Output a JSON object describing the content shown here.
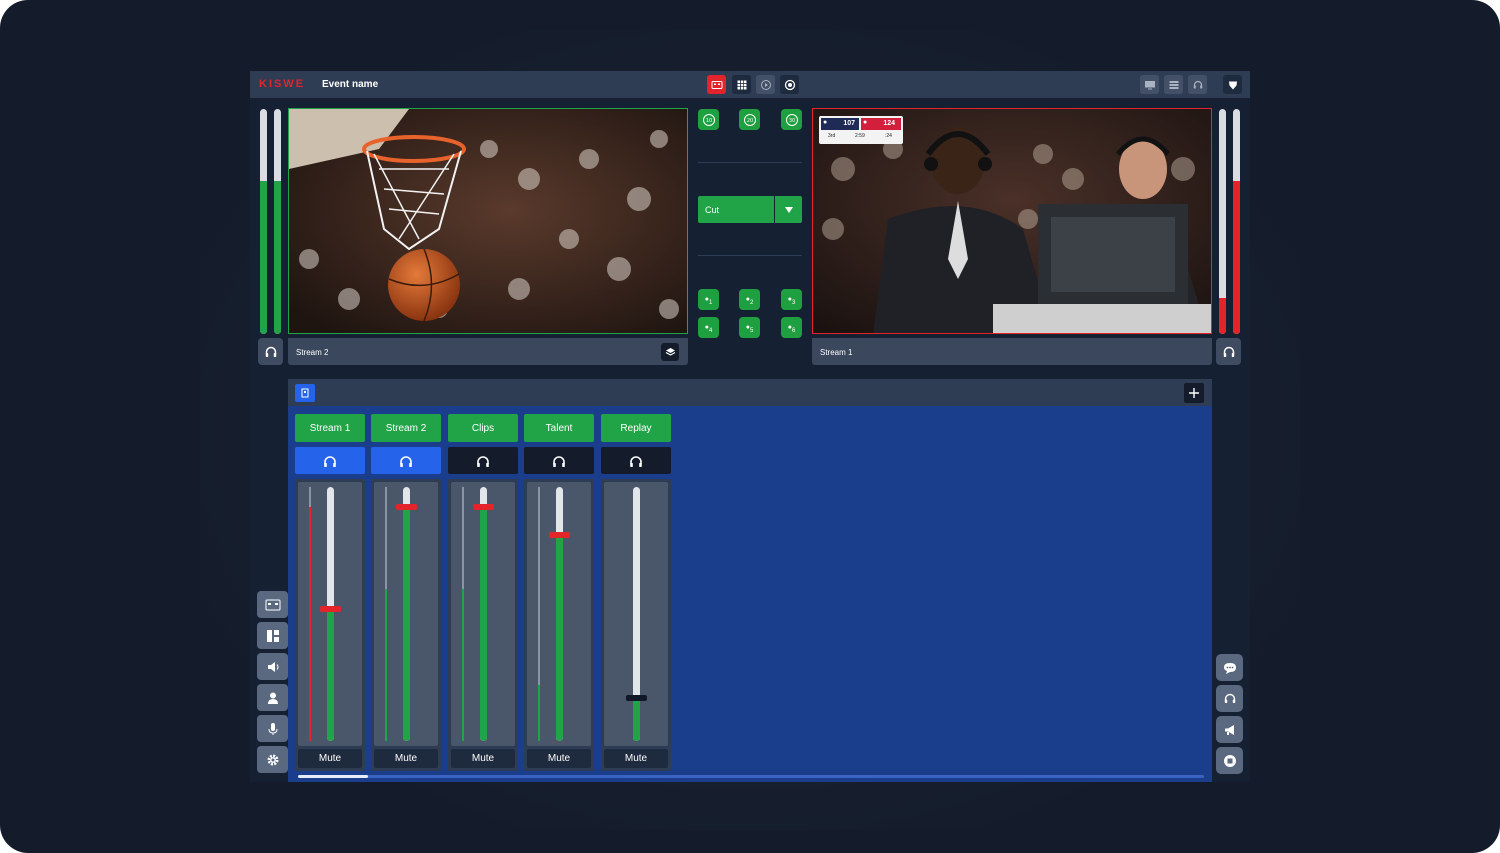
{
  "app": {
    "logo": "KISWE",
    "event_name": "Event name"
  },
  "streams": {
    "left_caption": "Stream 2",
    "right_caption": "Stream 1"
  },
  "scorebug": {
    "team_a_score": "107",
    "team_b_score": "124",
    "period": "3rd",
    "clock": "2:59",
    "shot_clock": ":24"
  },
  "transition": {
    "cut_label": "Cut"
  },
  "replay_buttons": [
    "10",
    "20",
    "30"
  ],
  "mic_buttons": [
    "1",
    "2",
    "3",
    "4",
    "5",
    "6"
  ],
  "mixer": {
    "channels": [
      {
        "label": "Stream 1",
        "mute": "Mute",
        "monitor_active": true,
        "level": 0.52,
        "meter": 0.92
      },
      {
        "label": "Stream 2",
        "mute": "Mute",
        "monitor_active": true,
        "level": 0.92,
        "meter": 0.6
      },
      {
        "label": "Clips",
        "mute": "Mute",
        "monitor_active": false,
        "level": 0.92,
        "meter": 0.6
      },
      {
        "label": "Talent",
        "mute": "Mute",
        "monitor_active": false,
        "level": 0.81,
        "meter": 0.22
      },
      {
        "label": "Replay",
        "mute": "Mute",
        "monitor_active": false,
        "level": 0.17,
        "meter": 0
      }
    ]
  },
  "colors": {
    "accent_green": "#21a347",
    "accent_red": "#e3242b",
    "monitor_active": "#2563eb",
    "mixer_bg": "#1a3d8c"
  }
}
